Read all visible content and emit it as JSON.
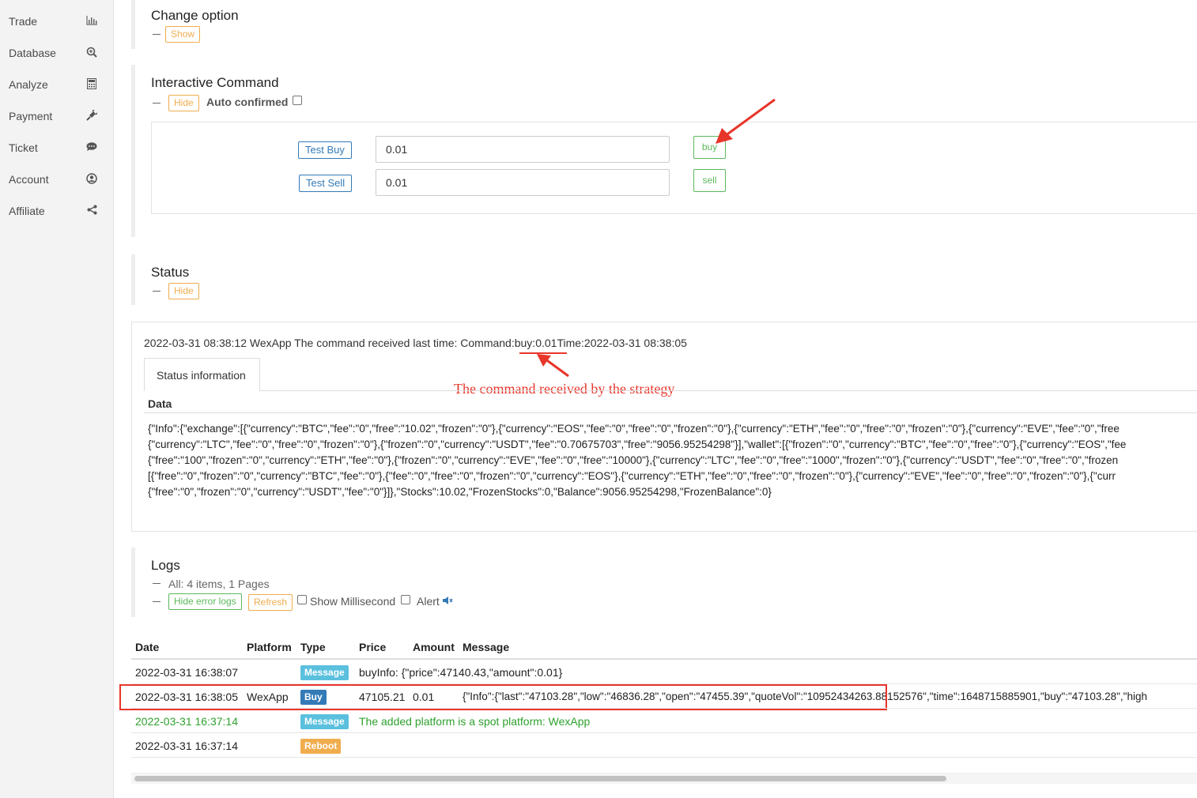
{
  "sidebar": {
    "items": [
      {
        "label": "Trade",
        "icon": "bar-chart-icon",
        "glyph": "📊"
      },
      {
        "label": "Database",
        "icon": "zoom-in-icon",
        "glyph": "🔍"
      },
      {
        "label": "Analyze",
        "icon": "calculator-icon",
        "glyph": "▦"
      },
      {
        "label": "Payment",
        "icon": "plug-icon",
        "glyph": "✎"
      },
      {
        "label": "Ticket",
        "icon": "comment-icon",
        "glyph": "●"
      },
      {
        "label": "Account",
        "icon": "user-circle-icon",
        "glyph": "◉"
      },
      {
        "label": "Affiliate",
        "icon": "share-icon",
        "glyph": "⋖"
      }
    ]
  },
  "change_option": {
    "title": "Change option",
    "toggle_label": "Show"
  },
  "interactive": {
    "title": "Interactive Command",
    "toggle_label": "Hide",
    "auto_confirmed_label": "Auto confirmed",
    "commands": [
      {
        "label": "Test Buy",
        "value": "0.01",
        "action_label": "buy"
      },
      {
        "label": "Test Sell",
        "value": "0.01",
        "action_label": "sell"
      }
    ]
  },
  "status": {
    "title": "Status",
    "toggle_label": "Hide",
    "line": "2022-03-31 08:38:12 WexApp The command received last time: Command:buy:0.01Time:2022-03-31 08:38:05",
    "tab_label": "Status information",
    "data_header": "Data",
    "annotation": "The command received by the strategy",
    "data_lines": [
      "{\"Info\":{\"exchange\":[{\"currency\":\"BTC\",\"fee\":\"0\",\"free\":\"10.02\",\"frozen\":\"0\"},{\"currency\":\"EOS\",\"fee\":\"0\",\"free\":\"0\",\"frozen\":\"0\"},{\"currency\":\"ETH\",\"fee\":\"0\",\"free\":\"0\",\"frozen\":\"0\"},{\"currency\":\"EVE\",\"fee\":\"0\",\"free",
      "{\"currency\":\"LTC\",\"fee\":\"0\",\"free\":\"0\",\"frozen\":\"0\"},{\"frozen\":\"0\",\"currency\":\"USDT\",\"fee\":\"0.70675703\",\"free\":\"9056.95254298\"}],\"wallet\":[{\"frozen\":\"0\",\"currency\":\"BTC\",\"fee\":\"0\",\"free\":\"0\"},{\"currency\":\"EOS\",\"fee",
      "{\"free\":\"100\",\"frozen\":\"0\",\"currency\":\"ETH\",\"fee\":\"0\"},{\"frozen\":\"0\",\"currency\":\"EVE\",\"fee\":\"0\",\"free\":\"10000\"},{\"currency\":\"LTC\",\"fee\":\"0\",\"free\":\"1000\",\"frozen\":\"0\"},{\"currency\":\"USDT\",\"fee\":\"0\",\"free\":\"0\",\"frozen",
      "[{\"free\":\"0\",\"frozen\":\"0\",\"currency\":\"BTC\",\"fee\":\"0\"},{\"fee\":\"0\",\"free\":\"0\",\"frozen\":\"0\",\"currency\":\"EOS\"},{\"currency\":\"ETH\",\"fee\":\"0\",\"free\":\"0\",\"frozen\":\"0\"},{\"currency\":\"EVE\",\"fee\":\"0\",\"free\":\"0\",\"frozen\":\"0\"},{\"curr",
      "{\"free\":\"0\",\"frozen\":\"0\",\"currency\":\"USDT\",\"fee\":\"0\"}]},\"Stocks\":10.02,\"FrozenStocks\":0,\"Balance\":9056.95254298,\"FrozenBalance\":0}"
    ]
  },
  "logs": {
    "title": "Logs",
    "summary": "All: 4 items, 1 Pages",
    "hide_error_label": "Hide error logs",
    "refresh_label": "Refresh",
    "show_ms_label": "Show Millisecond",
    "alert_label": "Alert",
    "columns": [
      "Date",
      "Platform",
      "Type",
      "Price",
      "Amount",
      "Message"
    ],
    "rows": [
      {
        "date": "2022-03-31 16:38:07",
        "platform": "",
        "type": "Message",
        "price": "",
        "amount": "",
        "message": "buyInfo: {\"price\":47140.43,\"amount\":0.01}"
      },
      {
        "date": "2022-03-31 16:38:05",
        "platform": "WexApp",
        "type": "Buy",
        "price": "47105.21",
        "amount": "0.01",
        "message": "{\"Info\":{\"last\":\"47103.28\",\"low\":\"46836.28\",\"open\":\"47455.39\",\"quoteVol\":\"10952434263.88152576\",\"time\":1648715885901,\"buy\":\"47103.28\",\"high"
      },
      {
        "date": "2022-03-31 16:37:14",
        "platform": "",
        "type": "Message",
        "price": "",
        "amount": "",
        "message": "The added platform is a spot platform: WexApp"
      },
      {
        "date": "2022-03-31 16:37:14",
        "platform": "",
        "type": "Reboot",
        "price": "",
        "amount": "",
        "message": ""
      }
    ]
  },
  "colors": {
    "accent_orange": "#f0ad4e",
    "accent_blue": "#337ab7",
    "accent_green": "#5cb85c",
    "badge_message": "#5bc0de",
    "badge_buy": "#337ab7",
    "badge_reboot": "#f0ad4e",
    "annotation_red": "#e8352a"
  }
}
